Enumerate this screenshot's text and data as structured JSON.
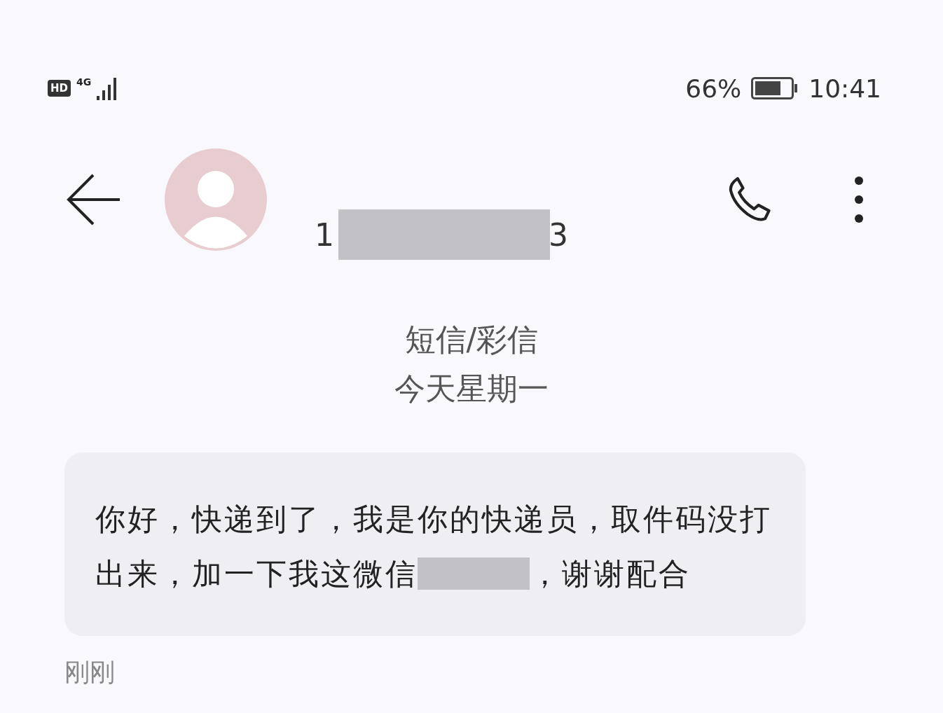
{
  "status_bar": {
    "hd_badge": "HD",
    "network": "4G",
    "battery_text": "66%",
    "time": "10:41"
  },
  "header": {
    "number_start": "1",
    "number_end": "3"
  },
  "thread": {
    "channel": "短信/彩信",
    "date": "今天星期一"
  },
  "messages": [
    {
      "line_1": "你好，快递到了，我是你的快递员，取件码没打",
      "line_2_before": "出来，加一下我这微信",
      "line_2_after": "，谢谢配合",
      "time": "刚刚"
    }
  ]
}
